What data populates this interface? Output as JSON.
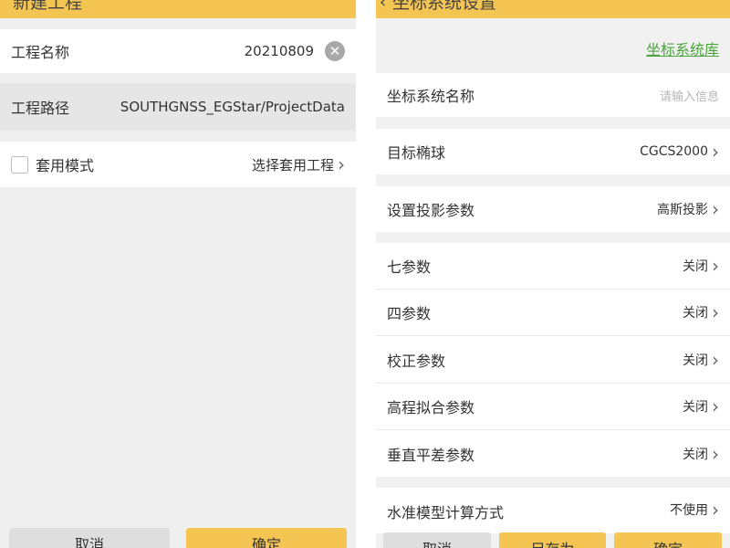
{
  "left": {
    "title": "新建工程",
    "project_name_label": "工程名称",
    "project_name_value": "20210809",
    "clear_glyph": "✕",
    "project_path_label": "工程路径",
    "project_path_value": "SOUTHGNSS_EGStar/ProjectData",
    "template_mode_label": "套用模式",
    "template_mode_checked": false,
    "select_template_label": "选择套用工程",
    "cancel_label": "取消",
    "confirm_label": "确定"
  },
  "right": {
    "title": "坐标系统设置",
    "library_link": "坐标系统库",
    "rows": [
      {
        "label": "坐标系统名称",
        "value": "请输入信息"
      },
      {
        "label": "目标椭球",
        "value": "CGCS2000"
      },
      {
        "label": "设置投影参数",
        "value": "高斯投影"
      },
      {
        "label": "七参数",
        "value": "关闭"
      },
      {
        "label": "四参数",
        "value": "关闭"
      },
      {
        "label": "校正参数",
        "value": "关闭"
      },
      {
        "label": "高程拟合参数",
        "value": "关闭"
      },
      {
        "label": "垂直平差参数",
        "value": "关闭"
      },
      {
        "label": "水准模型计算方式",
        "value": "不使用"
      }
    ],
    "cancel_label": "取消",
    "save_as_label": "另存为",
    "confirm_label": "确定"
  },
  "colors": {
    "accent": "#f5c553",
    "link": "#4aa43b",
    "background": "#efefef"
  },
  "icons": {
    "clear": "clear-icon",
    "chevron": "chevron-right-icon",
    "back": "back-arrow-icon"
  }
}
